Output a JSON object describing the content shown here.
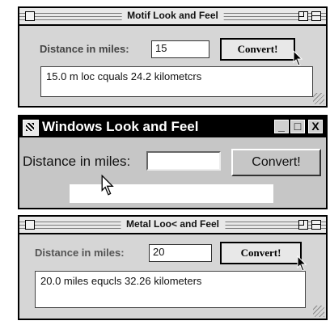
{
  "motif": {
    "title": "Motif Look and Feel",
    "label": "Distance in miles:",
    "input_value": "15",
    "button": "Convert!",
    "output": "15.0 m loc cquals 24.2 kilometcrs"
  },
  "windows": {
    "title": "Windows Look and Feel",
    "label": "Distance in miles:",
    "input_value": "",
    "button": "Convert!",
    "output": "",
    "minimize": "_",
    "maximize": "□",
    "close": "X"
  },
  "metal": {
    "title": "Metal Loo< and Feel",
    "label": "Distance in miles:",
    "input_value": "20",
    "button": "Convert!",
    "output": "20.0 miles equcls 32.26 kilometers"
  },
  "icons": [
    "close-box-icon",
    "zoom-box-icon",
    "collapse-box-icon",
    "grow-box-icon",
    "pointer-cursor-icon",
    "system-menu-icon"
  ]
}
